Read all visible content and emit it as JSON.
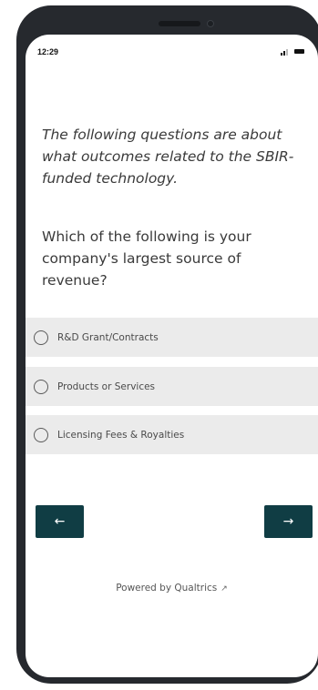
{
  "status_bar": {
    "time": "12:29",
    "signal_icon": "signal-icon",
    "battery_icon": "battery-icon"
  },
  "survey": {
    "intro": "The following questions are about what outcomes related to the SBIR-funded technology.",
    "question": "Which of the following is your company's largest source of revenue?",
    "choices": [
      {
        "label": "R&D Grant/Contracts",
        "selected": false
      },
      {
        "label": "Products or Services",
        "selected": false
      },
      {
        "label": "Licensing Fees & Royalties",
        "selected": false
      }
    ]
  },
  "navigation": {
    "back_label": "←",
    "next_label": "→"
  },
  "footer": {
    "powered_by": "Powered by Qualtrics",
    "external_icon": "external-link-icon"
  },
  "colors": {
    "button_bg": "#103d44",
    "choice_bg": "#ebebeb",
    "text": "#3a3a3a",
    "frame": "#26292e"
  }
}
